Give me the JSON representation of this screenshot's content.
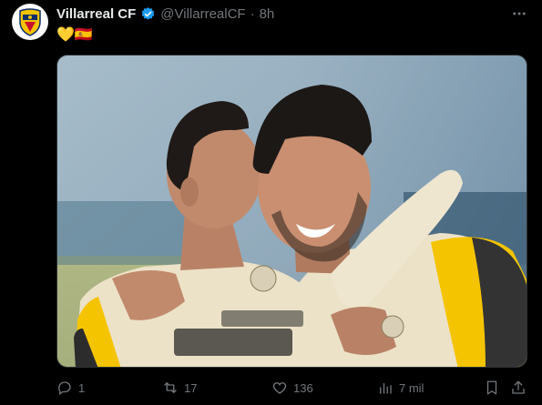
{
  "account": {
    "display_name": "Villarreal CF",
    "handle": "@VillarrealCF",
    "separator": "·",
    "time": "8h",
    "verified": true,
    "avatar_icon": "villarreal-crest-icon"
  },
  "post": {
    "emoji_text": "💛🇪🇦",
    "media_icon": "photo-players-embrace"
  },
  "actions": {
    "reply_count": "1",
    "repost_count": "17",
    "like_count": "136",
    "views_count": "7 mil"
  },
  "colors": {
    "background": "#000000",
    "text": "#e7e9ea",
    "muted": "#71767b",
    "verified": "#1d9bf0",
    "club_yellow": "#f5c400"
  }
}
